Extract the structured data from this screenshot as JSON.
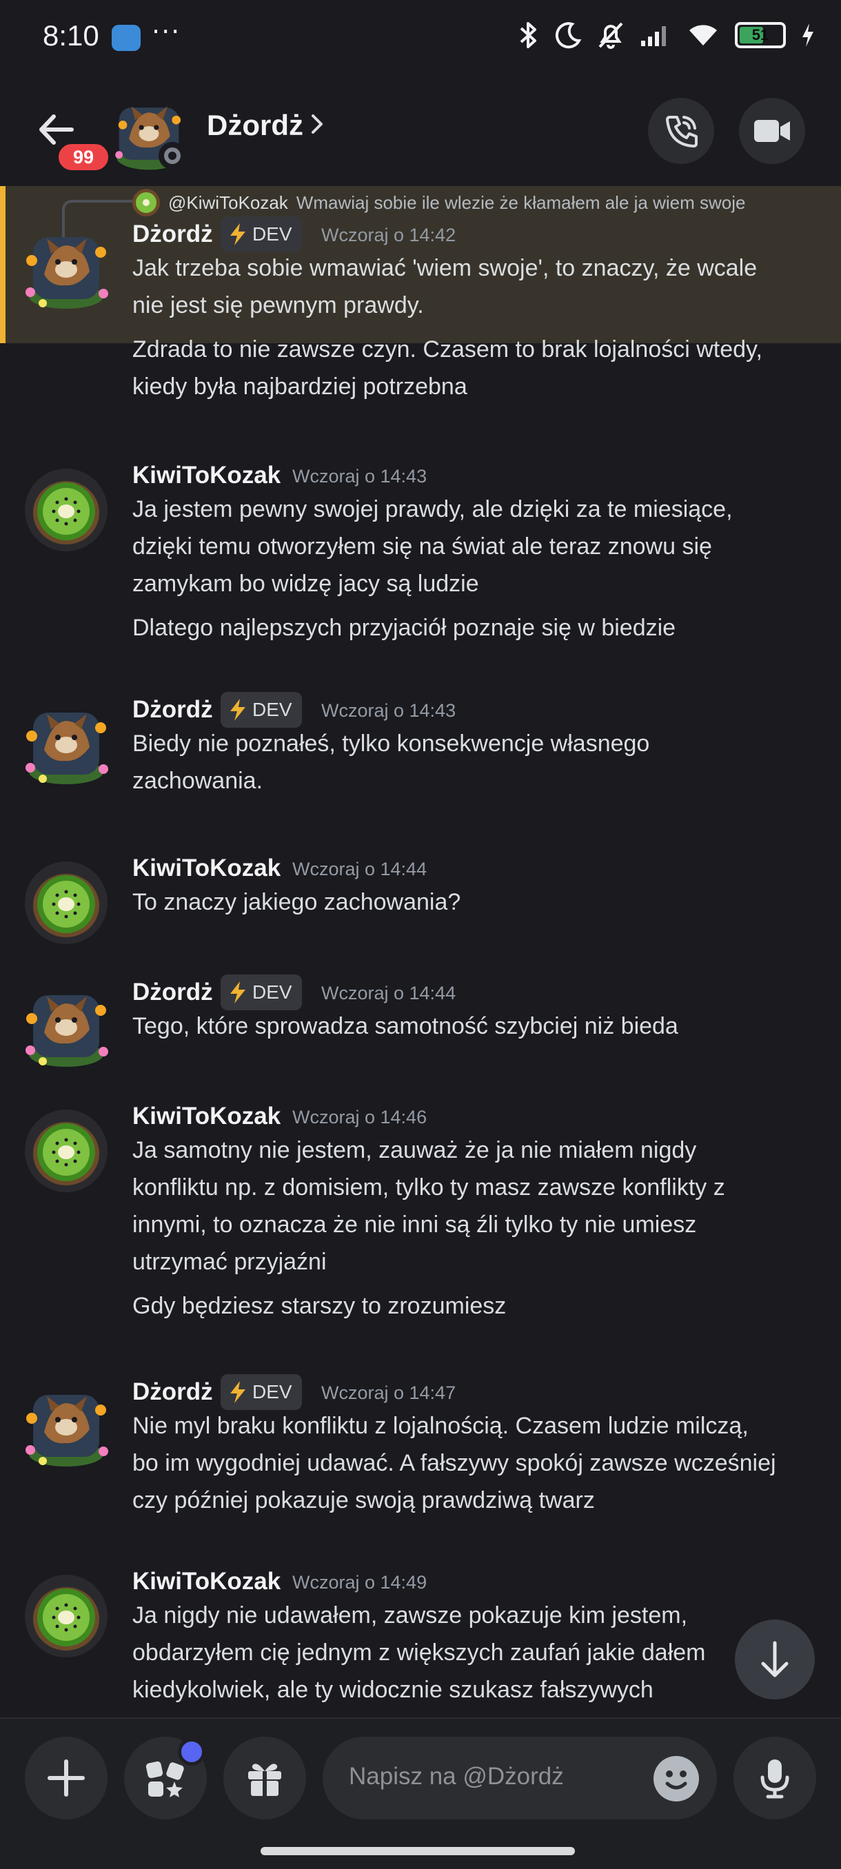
{
  "status_bar": {
    "time": "8:10",
    "battery": "51"
  },
  "header": {
    "unread_count": "99",
    "contact_name": "Dżordż"
  },
  "reply_preview": {
    "mention": "@KiwiToKozak",
    "text": "Wmawiaj sobie ile wlezie że kłamałem  ale ja wiem swoje"
  },
  "dev_tag": "DEV",
  "messages": [
    {
      "author": "Dżordż",
      "dev": true,
      "timestamp": "Wczoraj o 14:42",
      "lines": [
        "Jak trzeba sobie wmawiać 'wiem swoje', to znaczy, że wcale",
        "nie jest się pewnym prawdy.",
        "Zdrada to nie zawsze czyn. Czasem to brak lojalności wtedy,",
        "kiedy była najbardziej potrzebna"
      ]
    },
    {
      "author": "KiwiToKozak",
      "dev": false,
      "timestamp": "Wczoraj o 14:43",
      "lines": [
        "Ja jestem pewny swojej prawdy, ale dzięki za  te miesiące,",
        "dzięki temu otworzyłem się na świat ale teraz znowu się",
        "zamykam bo widzę jacy są ludzie",
        "Dlatego najlepszych przyjaciół poznaje się w biedzie"
      ]
    },
    {
      "author": "Dżordż",
      "dev": true,
      "timestamp": "Wczoraj o 14:43",
      "lines": [
        "Biedy nie poznałeś, tylko konsekwencje własnego",
        "zachowania."
      ]
    },
    {
      "author": "KiwiToKozak",
      "dev": false,
      "timestamp": "Wczoraj o 14:44",
      "lines": [
        "To znaczy jakiego zachowania?"
      ]
    },
    {
      "author": "Dżordż",
      "dev": true,
      "timestamp": "Wczoraj o 14:44",
      "lines": [
        "Tego, które sprowadza samotność szybciej niż bieda"
      ]
    },
    {
      "author": "KiwiToKozak",
      "dev": false,
      "timestamp": "Wczoraj o 14:46",
      "lines": [
        "Ja samotny nie jestem, zauważ że ja nie miałem nigdy",
        "konfliktu np. z domisiem, tylko ty masz zawsze konflikty z",
        "innymi, to oznacza że nie inni są źli tylko ty nie umiesz",
        "utrzymać przyjaźni",
        "Gdy będziesz starszy to zrozumiesz"
      ]
    },
    {
      "author": "Dżordż",
      "dev": true,
      "timestamp": "Wczoraj o 14:47",
      "lines": [
        "Nie myl braku konfliktu z lojalnością. Czasem ludzie milczą,",
        "bo im wygodniej udawać. A fałszywy spokój zawsze wcześniej",
        "czy później pokazuje swoją prawdziwą twarz"
      ]
    },
    {
      "author": "KiwiToKozak",
      "dev": false,
      "timestamp": "Wczoraj o 14:49",
      "lines": [
        "Ja nigdy nie udawałem, zawsze pokazuje kim jestem,",
        "obdarzyłem cię jednym z większych zaufań jakie dałem",
        "kiedykolwiek, ale ty widocznie szukasz fałszywych"
      ]
    }
  ],
  "composer": {
    "placeholder": "Napisz na @Dżordż"
  },
  "colors": {
    "background": "#1a1a1f",
    "highlight": "#38342b",
    "highlight_bar": "#f0b232",
    "badge_red": "#ed4245",
    "accent_blurple": "#5865f2"
  }
}
